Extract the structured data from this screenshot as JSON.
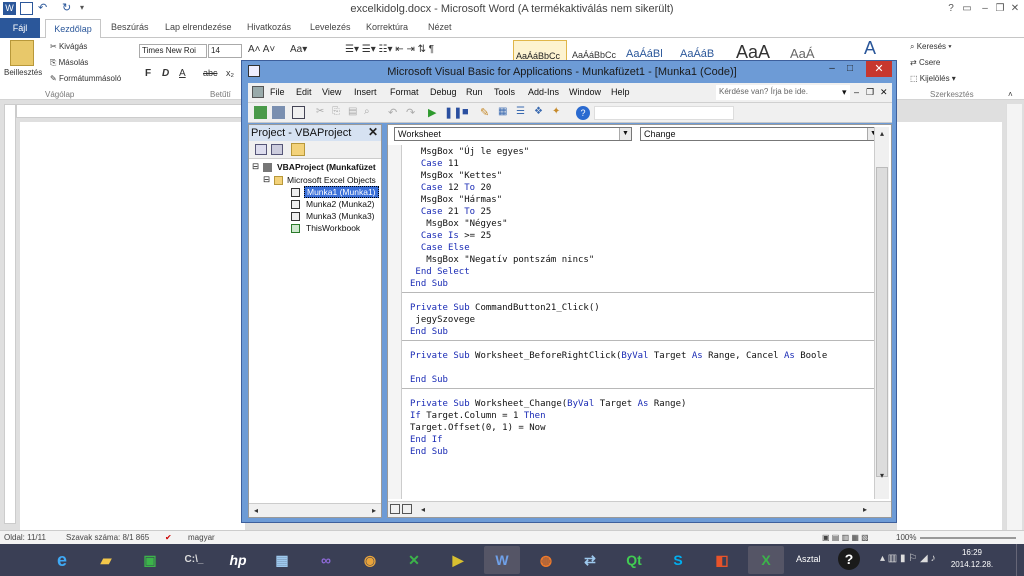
{
  "word": {
    "title": "excelkidolg.docx - Microsoft Word (A termékaktiválás nem sikerült)",
    "tabs": [
      "Fájl",
      "Kezdőlap",
      "Beszúrás",
      "Lap elrendezése",
      "Hivatkozás",
      "Levelezés",
      "Korrektúra",
      "Nézet"
    ],
    "ribbon": {
      "paste": "Beillesztés",
      "cut": "Kivágás",
      "copy": "Másolás",
      "format_painter": "Formátummásoló",
      "clipboard_group": "Vágólap",
      "font_name": "Times New Roi",
      "font_size": "14",
      "font_group": "Betűtí",
      "style1": "AaÁáBbCc",
      "style2": "AaÁáBbCc",
      "style3": "AaÁáBl",
      "style4": "AaÁáB",
      "style5": "AaA",
      "style6": "AaÁ",
      "find": "Keresés",
      "replace": "Csere",
      "select": "Kijelölés",
      "editing_group": "Szerkesztés"
    },
    "status": {
      "page": "Oldal: 11/11",
      "words": "Szavak száma: 8/1 865",
      "language": "magyar",
      "zoom": "100%"
    }
  },
  "vba": {
    "title": "Microsoft Visual Basic for Applications - Munkafüzet1 - [Munka1 (Code)]",
    "menus": [
      "File",
      "Edit",
      "View",
      "Insert",
      "Format",
      "Debug",
      "Run",
      "Tools",
      "Add-Ins",
      "Window",
      "Help"
    ],
    "help_placeholder": "Kérdése van? Írja be ide.",
    "project": {
      "title": "Project - VBAProject",
      "root": "VBAProject (Munkafüzet",
      "folder": "Microsoft Excel Objects",
      "items": [
        "Munka1 (Munka1)",
        "Munka2 (Munka2)",
        "Munka3 (Munka3)",
        "ThisWorkbook"
      ]
    },
    "object_combo": "Worksheet",
    "proc_combo": "Change",
    "code": [
      {
        "t": "  MsgBox \"Új le egyes\""
      },
      {
        "t": "  Case 11"
      },
      {
        "t": "  MsgBox \"Kettes\""
      },
      {
        "t": "  Case 12 To 20"
      },
      {
        "t": "  MsgBox \"Hármas\""
      },
      {
        "t": "  Case 21 To 25"
      },
      {
        "t": "   MsgBox \"Négyes\""
      },
      {
        "t": "  Case Is >= 25"
      },
      {
        "t": "  Case Else"
      },
      {
        "t": "   MsgBox \"Negatív pontszám nincs\""
      },
      {
        "t": " End Select"
      },
      {
        "t": "End Sub"
      },
      {
        "t": ""
      },
      {
        "t": "Private Sub CommandButton21_Click()"
      },
      {
        "t": " jegySzovege"
      },
      {
        "t": "End Sub"
      },
      {
        "t": ""
      },
      {
        "t": "Private Sub Worksheet_BeforeRightClick(ByVal Target As Range, Cancel As Boole"
      },
      {
        "t": ""
      },
      {
        "t": "End Sub"
      },
      {
        "t": ""
      },
      {
        "t": "Private Sub Worksheet_Change(ByVal Target As Range)"
      },
      {
        "t": "If Target.Column = 1 Then"
      },
      {
        "t": "Target.Offset(0, 1) = Now"
      },
      {
        "t": "End If"
      },
      {
        "t": "End Sub"
      }
    ]
  },
  "taskbar": {
    "desktop_label": "Asztal",
    "time": "16:29",
    "date": "2014.12.28.",
    "icons": [
      "ie-icon",
      "explorer-icon",
      "store-icon",
      "cmd-icon",
      "hp-icon",
      "calculator-icon",
      "visual-studio-icon",
      "chrome-icon",
      "xamarin-icon",
      "media-icon",
      "word-icon",
      "firefox-icon",
      "network-icon",
      "qt-icon",
      "skype-icon",
      "office-icon",
      "excel-icon"
    ]
  },
  "colors": {
    "word_blue": "#2b579a",
    "vba_frame": "#6d9bd6",
    "keyword": "#1a2bb5",
    "close_red": "#c7372e",
    "taskbar": "#3a3f55"
  }
}
